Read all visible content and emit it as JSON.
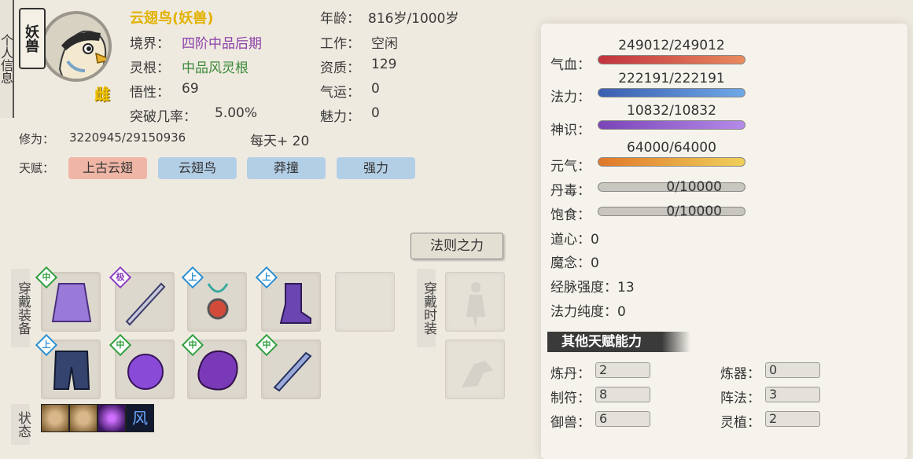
{
  "banner": {
    "text": "个人信息"
  },
  "profile": {
    "type_badge": "妖兽",
    "gender": "雌",
    "name": "云翅鸟(妖兽)",
    "realm_label": "境界：",
    "realm_value": "四阶中品后期",
    "root_label": "灵根：",
    "root_value": "中品风灵根",
    "comprehension_label": "悟性：",
    "comprehension_value": "69",
    "breakthrough_label": "突破几率：",
    "breakthrough_value": "5.00%",
    "age_label": "年龄：",
    "age_value": "816岁/1000岁",
    "job_label": "工作：",
    "job_value": "空闲",
    "aptitude_label": "资质：",
    "aptitude_value": "129",
    "luck_label": "气运：",
    "luck_value": "0",
    "charm_label": "魅力：",
    "charm_value": "0",
    "cultivation_label": "修为：",
    "cultivation_value": "3220945/29150936",
    "daily_label": "每天+ 20",
    "talent_label": "天赋："
  },
  "talents": [
    {
      "label": "上古云翅",
      "color": "#efb6a6"
    },
    {
      "label": "云翅鸟",
      "color": "#b3cfe6"
    },
    {
      "label": "莽撞",
      "color": "#b3cfe6"
    },
    {
      "label": "强力",
      "color": "#b3cfe6"
    }
  ],
  "equipment": {
    "side_label": "穿戴装备",
    "slots": [
      {
        "grade": "中",
        "grade_color": "#2f9e3c",
        "icon": "purple-robe-icon"
      },
      {
        "grade": "极",
        "grade_color": "#8b3fbf",
        "icon": "sword-icon"
      },
      {
        "grade": "上",
        "grade_color": "#2b8fd1",
        "icon": "pendant-icon"
      },
      {
        "grade": "上",
        "grade_color": "#2b8fd1",
        "icon": "boots-icon"
      },
      {
        "grade": "",
        "icon": "empty-slot-icon"
      },
      {
        "grade": "上",
        "grade_color": "#2b8fd1",
        "icon": "armor-pants-icon"
      },
      {
        "grade": "中",
        "grade_color": "#2f9e3c",
        "icon": "purple-orb-icon"
      },
      {
        "grade": "中",
        "grade_color": "#2f9e3c",
        "icon": "purple-stone-icon"
      },
      {
        "grade": "中",
        "grade_color": "#2f9e3c",
        "icon": "blade-icon"
      }
    ]
  },
  "fashion": {
    "side_label": "穿戴时装",
    "law_button": "法则之力"
  },
  "status": {
    "side_label": "状态",
    "icons": [
      "taiji-icon",
      "taiji-icon",
      "purple-vortex-icon",
      "wind-rune-icon"
    ]
  },
  "stats": {
    "hp_label": "气血：",
    "hp_value": "249012/249012",
    "mp_label": "法力：",
    "mp_value": "222191/222191",
    "sense_label": "神识：",
    "sense_value": "10832/10832",
    "vital_label": "元气：",
    "vital_value": "64000/64000",
    "poison_label": "丹毒：",
    "poison_value": "0/10000",
    "food_label": "饱食：",
    "food_value": "0/10000",
    "dao_label": "道心：0",
    "demon_label": "魔念：0",
    "meridian_label": "经脉强度：13",
    "purity_label": "法力纯度：0"
  },
  "bar_colors": {
    "hp": [
      "#c2323e",
      "#e98a5e"
    ],
    "mp": [
      "#3a5fb0",
      "#6fa8e6"
    ],
    "sense": [
      "#7a44b8",
      "#b58ae8"
    ],
    "vital": [
      "#e0782a",
      "#f0d05a"
    ]
  },
  "other_talents": {
    "title": "其他天赋能力",
    "items": [
      {
        "label": "炼丹：",
        "value": "2"
      },
      {
        "label": "炼器：",
        "value": "0"
      },
      {
        "label": "制符：",
        "value": "8"
      },
      {
        "label": "阵法：",
        "value": "3"
      },
      {
        "label": "御兽：",
        "value": "6"
      },
      {
        "label": "灵植：",
        "value": "2"
      }
    ]
  }
}
